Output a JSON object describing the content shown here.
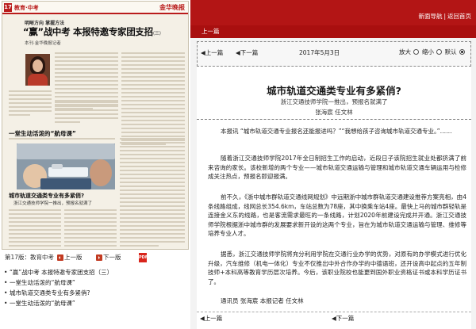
{
  "newspaper": {
    "page_num": "17",
    "section_label": "教育·中考",
    "masthead": "金华晚报",
    "kicker": "明晰方向 掌握方法",
    "headline": "“赢”战中考 本报特邀专家团支招",
    "headline_tag": "(三)",
    "byline": "本刊·金华晚报记者",
    "sub_story1": "一堂生动活泼的“航母课”",
    "sub_story2": "城市轨道交通类专业有多紧俏?",
    "sub_story3": "浙江交通技师学院一推出，预报名就满了"
  },
  "page_nav": {
    "label": "第17版：教育中考",
    "prev": "上一版",
    "next": "下一版",
    "pdf": "PDF"
  },
  "headlines": [
    "“赢”战中考 本报特邀专家团支招（三）",
    "一堂生动活泼的“航母课”",
    "城市轨道交通类专业有多紧俏?",
    "一堂生动活泼的“航母课”"
  ],
  "topbar": {
    "nav_link": "新面导航",
    "back_link": "返回首页",
    "separator": "|",
    "prev_article": "上一篇"
  },
  "toolbar": {
    "prev": "上一篇",
    "next": "下一篇",
    "date": "2017年5月3日",
    "zoom_in": "放大",
    "zoom_out": "缩小",
    "default": "默认"
  },
  "article": {
    "title": "城市轨道交通类专业有多紧俏?",
    "subtitle": "浙江交通技师学院一推出，预报名就满了",
    "authors": "张海宸 任文林",
    "paragraphs": [
      "本报讯 “城市轨道交通专业报名还能报进吗？”“我想给孩子咨询城市轨道交通专业。”……",
      "随着浙江交通技师学院2017年全日制招生工作的启动，近段日子该院招生就业处都挤满了前来咨询的家长。该校新增的两个专业——城市轨道交通运输与管理和城市轨道交通车辆运用与检修成关注热点，预报名即迎报满。",
      "前不久，《浙中城市群轨道交通线网规划》中远期浙中城市群轨道交通建设推荐方案亮相，由4条线路组成，线网总长354.6km，车站总数为78座，其中换乘车站4座。最快上马的城市群轻轨是连接金义东的线路，也是客流需求最旺的一条线路，计划2020年前建设完成并开通。浙江交通技师学院根据浙中城市群的发展要求新开设的这两个专业，旨在为城市轨道交通运输与管理、维修等培养专业人才。",
      "据悉，浙江交通技师学院将充分利用学院在交通行业办学的优势，对原有的办学模式进行优化升级，汽车维修（机电一体化）专业不仅推出中外合作办学的中德语班，还开设高中起点的五年制技师+本科高等教育学历层次培养。今后，该职业院校也能更到国外职业资格证书或本科学历证书了。",
      "通讯员 张海宸 本报记者 任文林"
    ],
    "prev": "上一篇",
    "next": "下一篇"
  },
  "colors": {
    "brand_red": "#b31515",
    "paper_bg": "#f4f0e6",
    "pdf_red": "#d9251c"
  }
}
